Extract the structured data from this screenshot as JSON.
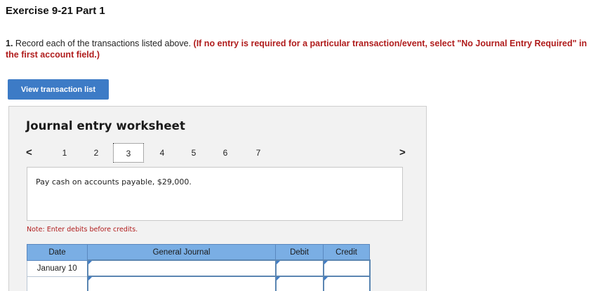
{
  "header": {
    "title": "Exercise 9-21 Part 1"
  },
  "instructions": {
    "number": "1.",
    "text": " Record each of the transactions listed above. ",
    "warning": "(If no entry is required for a particular transaction/event, select \"No Journal Entry Required\" in the first account field.)"
  },
  "view_button": {
    "label": "View transaction list"
  },
  "worksheet": {
    "title": "Journal entry worksheet",
    "prev_arrow": "<",
    "next_arrow": ">",
    "pages": [
      "1",
      "2",
      "3",
      "4",
      "5",
      "6",
      "7"
    ],
    "active_page": "3",
    "description": "Pay cash on accounts payable, $29,000.",
    "note": "Note: Enter debits before credits."
  },
  "table": {
    "headers": {
      "date": "Date",
      "account": "General Journal",
      "debit": "Debit",
      "credit": "Credit"
    },
    "rows": [
      {
        "date": "January 10",
        "account": "",
        "debit": "",
        "credit": ""
      },
      {
        "date": "",
        "account": "",
        "debit": "",
        "credit": ""
      }
    ]
  },
  "colors": {
    "accent_button": "#3d7bc6",
    "table_header": "#7aaee4",
    "warning_text": "#b01c1c"
  }
}
